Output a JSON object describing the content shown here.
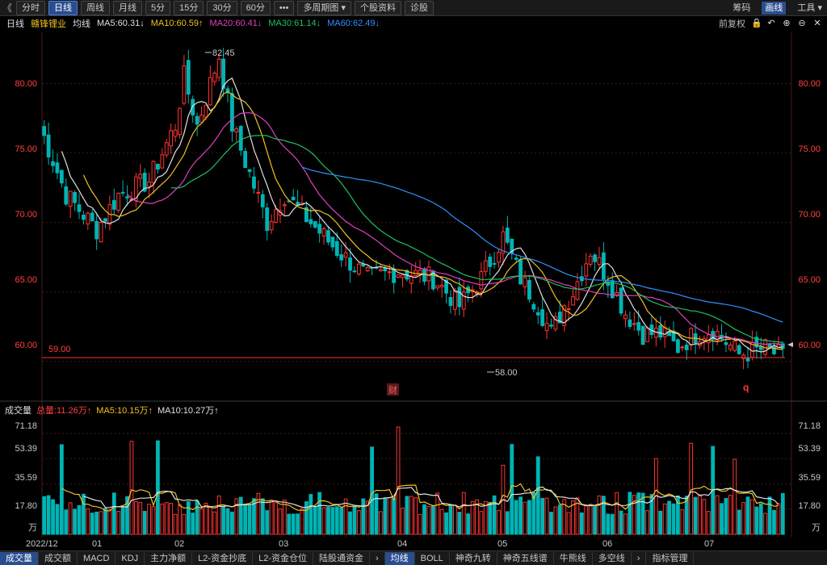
{
  "toolbar": {
    "back": "《",
    "buttons": [
      "分时",
      "日线",
      "周线",
      "月线",
      "5分",
      "15分",
      "30分",
      "60分",
      "•••",
      "多周期图 ▾",
      "个股资料",
      "诊股"
    ],
    "active_index": 1,
    "right": [
      "筹码",
      "画线",
      "工具 ▾"
    ],
    "right_active": 1
  },
  "info": {
    "period": "日线",
    "stock": "赣锋锂业",
    "avg": "均线",
    "ma5": "MA5:60.31↓",
    "ma10": "MA10:60.59↑",
    "ma20": "MA20:60.41↓",
    "ma30": "MA30:61.14↓",
    "ma60": "MA60:62.49↓",
    "adjust": "前复权"
  },
  "price_axis": {
    "ticks": [
      "80.00",
      "75.00",
      "70.00",
      "65.00",
      "60.00"
    ],
    "tick_values": [
      80,
      75,
      70,
      65,
      60
    ],
    "range": [
      57.3,
      83.7
    ],
    "support_label": "59.00",
    "support_value": 59.0,
    "high_label": "82.45",
    "high_value": 82.45,
    "low_label": "58.00",
    "low_value": 58.0,
    "marker_cai": "财",
    "marker_q": "q"
  },
  "volume": {
    "title": "成交量",
    "total": "总量:11.26万↑",
    "ma5": "MA5:10.15万↑",
    "ma10": "MA10:10.27万↑",
    "ticks": [
      "71.18",
      "53.39",
      "35.59",
      "17.80"
    ],
    "tick_values": [
      71.18,
      53.39,
      35.59,
      17.8
    ],
    "unit": "万"
  },
  "dates": [
    "2022/12",
    "01",
    "02",
    "03",
    "04",
    "05",
    "06",
    "07"
  ],
  "bottom_tabs": [
    "成交量",
    "成交额",
    "MACD",
    "KDJ",
    "主力净额",
    "L2-资金抄底",
    "L2-资金仓位",
    "陆股通资金",
    "›",
    "均线",
    "BOLL",
    "神奇九转",
    "神奇五线谱",
    "牛熊线",
    "多空线",
    "›",
    "指标管理"
  ],
  "bottom_active": [
    0,
    9
  ],
  "colors": {
    "up": "#ff3333",
    "down": "#00b4b4",
    "ma5": "#e0e0e0",
    "ma10": "#f0c020",
    "ma20": "#e040c0",
    "ma30": "#20c060",
    "ma60": "#3090ff",
    "axis": "#ff4040",
    "grid": "#3a1a1a"
  }
}
